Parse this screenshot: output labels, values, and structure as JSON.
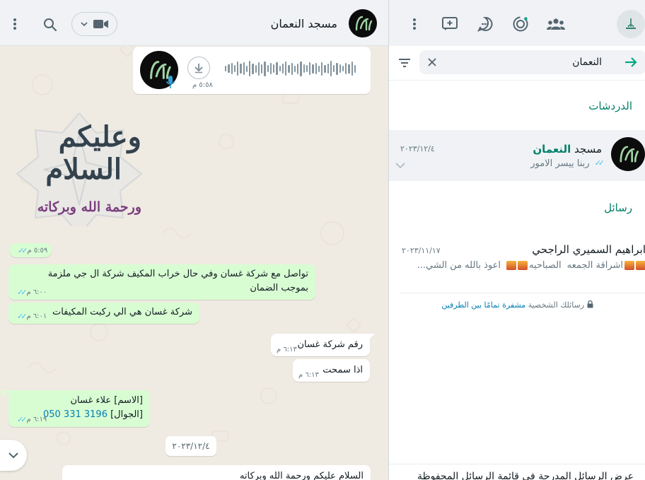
{
  "chat": {
    "title": "مسجد النعمان",
    "voice": {
      "time": "٥:٥٨ م"
    },
    "sticker_meta": {
      "time": "٥:٥٩ م"
    },
    "messages": [
      {
        "id": "m1",
        "dir": "out",
        "text": "تواصل مع شركة غسان وفي حال خراب المكيف شركة ال جي ملزمة بموجب الضمان",
        "time": "٦:٠٠ م"
      },
      {
        "id": "m2",
        "dir": "out",
        "text": "شركة غسان هي الي ركبت المكيفات",
        "time": "٦:٠١ م"
      },
      {
        "id": "m3",
        "dir": "in",
        "text": "رقم شركة غسان",
        "time": "٦:١٣ م"
      },
      {
        "id": "m4",
        "dir": "in",
        "text": "اذا سمحت",
        "time": "٦:١٣ م"
      },
      {
        "id": "m5",
        "dir": "out",
        "line1": "[الاسم] علاء غسان",
        "line2_label": "[الجوال]",
        "line2_phone": "050 331 3196",
        "time": "٦:١٩ م"
      }
    ],
    "date_divider": "٢٠٢٣/١٢/٤",
    "last_message_peek": "السلام عليكم ورحمة الله وبركاته",
    "sticker_text": {
      "line1": "وعليكم",
      "line2": "السلام",
      "line3": "ورحمة الله وبركاته"
    }
  },
  "sidebar": {
    "search": {
      "value": "النعمان"
    },
    "sections": {
      "chats": "الدردشات",
      "messages": "رسائل"
    },
    "chat_result": {
      "name_highlight": "النعمان",
      "name_rest": "مسجد",
      "last_message": "ربنا ييسر الامور",
      "date": "٢٠٢٣/١٢/٤"
    },
    "message_result": {
      "name": "ابراهيم السميري الراجحي",
      "date": "٢٠٢٣/١١/١٧",
      "snippet_a": "اشراقة الجمعه",
      "snippet_b": "الصباحيه",
      "snippet_c": "اعوذ بالله من الشي..."
    },
    "e2e": {
      "prefix": "رسائلك الشخصية",
      "link": "مشفرة تمامًا بين الطرفين"
    },
    "bottom_peek": "عرض الرسائل المدرجة في قائمة الرسائل المحفوظة"
  },
  "colors": {
    "accent": "#00a884",
    "outgoing_bubble": "#d9fdd3",
    "chat_bg": "#efeae2",
    "read_ticks": "#53bdeb"
  },
  "icons": [
    "menu-icon",
    "search-icon",
    "video-icon",
    "chevron-down-icon",
    "download-icon",
    "mic-icon",
    "new-chat-icon",
    "channels-icon",
    "status-icon",
    "communities-icon",
    "back-arrow-icon",
    "close-icon",
    "filter-icon",
    "lock-icon"
  ]
}
